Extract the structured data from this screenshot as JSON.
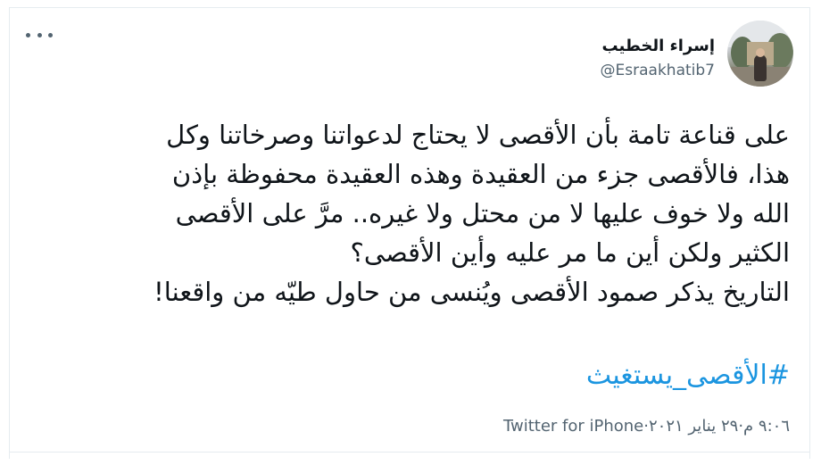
{
  "author": {
    "name": "إسراء الخطيب",
    "handle": "@Esraakhatib7",
    "avatar_icon": "profile-photo"
  },
  "menu_icon": "more-horizontal-icon",
  "tweet": {
    "lines": [
      "على قناعة تامة بأن الأقصى لا يحتاج لدعواتنا وصرخاتنا وكل",
      "هذا، فالأقصى جزء من العقيدة وهذه العقيدة محفوظة بإذن",
      "الله ولا خوف عليها لا من محتل ولا غيره.. مرَّ على الأقصى",
      "الكثير ولكن أين ما مر عليه وأين الأقصى؟",
      "التاريخ يذكر صمود الأقصى ويُنسى من حاول طيّه من واقعنا!"
    ],
    "hashtag": "#الأقصى_يستغيث"
  },
  "meta": {
    "time": "٩:٠٦ م",
    "separator1": " · ",
    "date": "٢٩ يناير ٢٠٢١",
    "separator2": " · ",
    "source": "Twitter for iPhone"
  },
  "colors": {
    "link": "#1b95e0",
    "secondary_text": "#536471",
    "border": "#e6ecf0"
  }
}
